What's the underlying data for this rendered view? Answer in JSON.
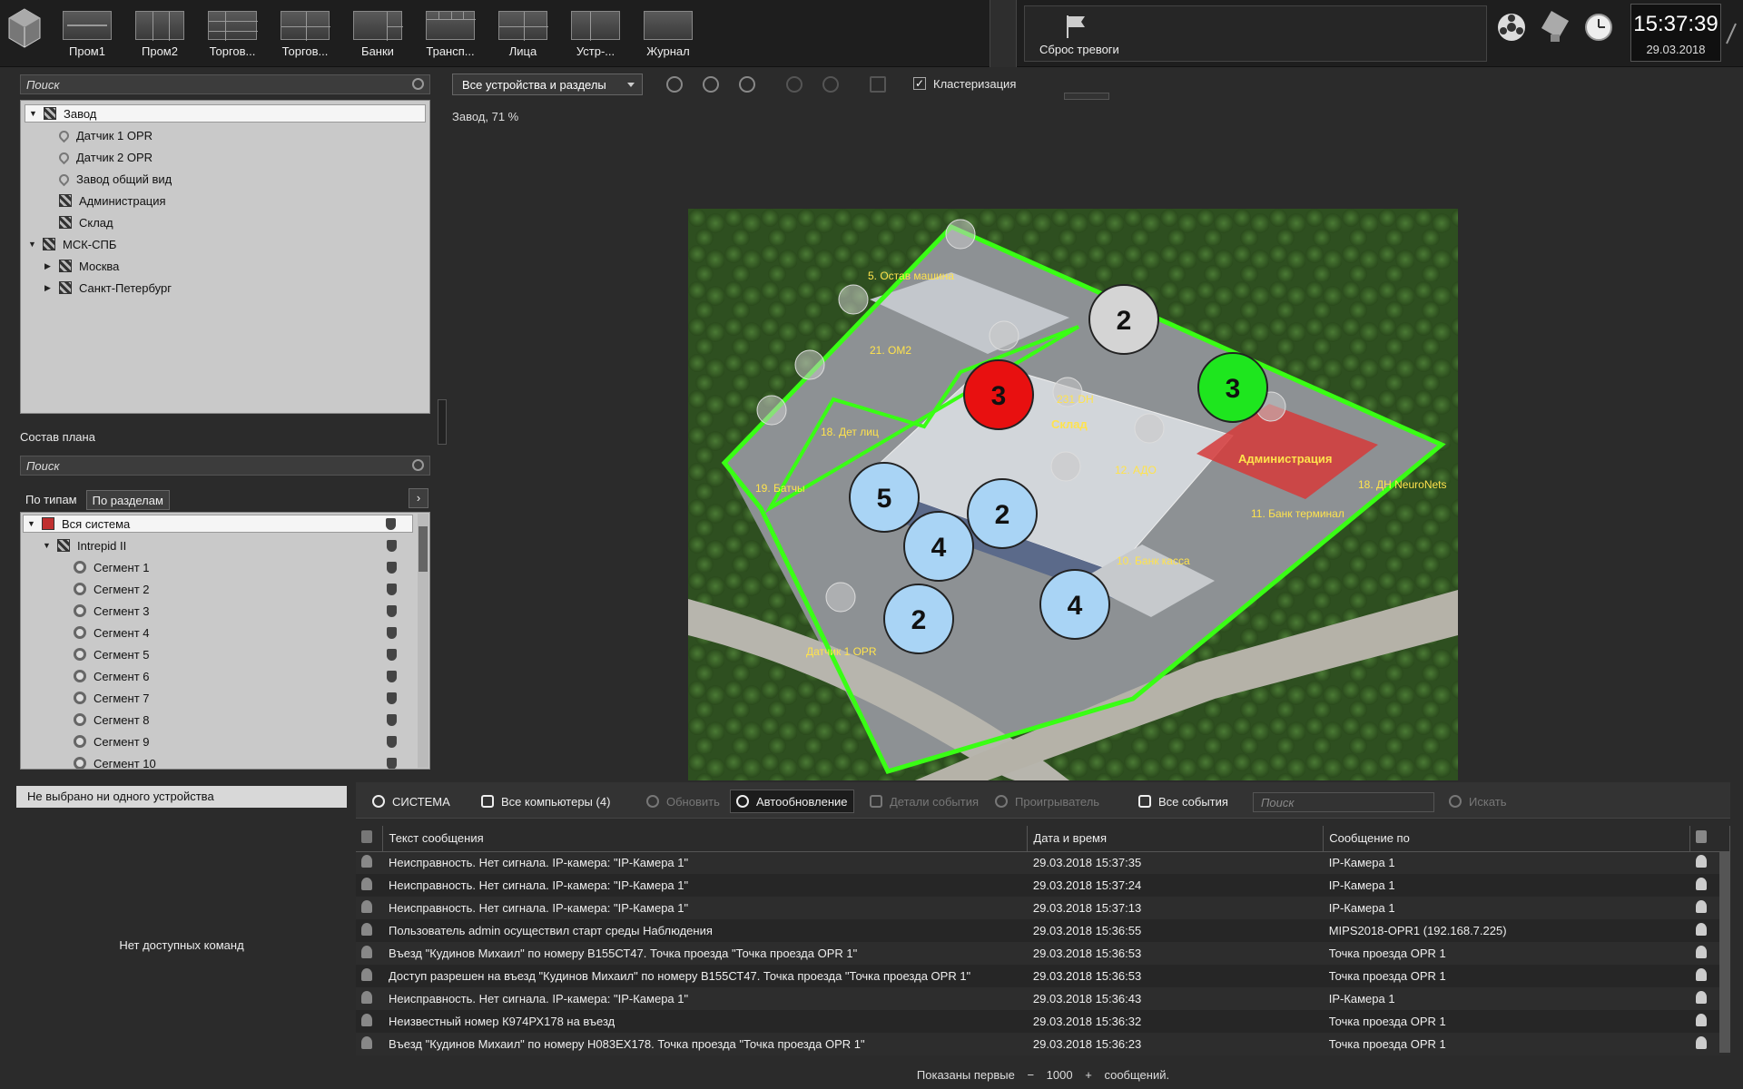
{
  "topbar": {
    "layouts": [
      {
        "label": "Пром1"
      },
      {
        "label": "Пром2"
      },
      {
        "label": "Торгов..."
      },
      {
        "label": "Торгов..."
      },
      {
        "label": "Банки"
      },
      {
        "label": "Трансп..."
      },
      {
        "label": "Лица"
      },
      {
        "label": "Устр-..."
      },
      {
        "label": "Журнал"
      }
    ],
    "alarm_reset": "Сброс тревоги",
    "time": "15:37:39",
    "date": "29.03.2018"
  },
  "left": {
    "search_placeholder": "Поиск",
    "tree": [
      {
        "label": "Завод",
        "level": 0,
        "type": "map",
        "expanded": true,
        "selected": true
      },
      {
        "label": "Датчик 1 OPR",
        "level": 1,
        "type": "pin"
      },
      {
        "label": "Датчик 2 OPR",
        "level": 1,
        "type": "pin"
      },
      {
        "label": "Завод общий вид",
        "level": 1,
        "type": "pin"
      },
      {
        "label": "Администрация",
        "level": 1,
        "type": "map"
      },
      {
        "label": "Склад",
        "level": 1,
        "type": "map"
      },
      {
        "label": "МСК-СПБ",
        "level": 0,
        "type": "map",
        "expanded": true
      },
      {
        "label": "Москва",
        "level": 1,
        "type": "map",
        "collapsed": true
      },
      {
        "label": "Санкт-Петербург",
        "level": 1,
        "type": "map",
        "collapsed": true
      }
    ],
    "plan_title": "Состав плана",
    "plan_search_placeholder": "Поиск",
    "tabs": {
      "by_type": "По типам",
      "by_section": "По разделам"
    },
    "plan_tree": [
      {
        "label": "Вся система",
        "level": 0
      },
      {
        "label": "Intrepid II",
        "level": 1
      },
      {
        "label": "Сегмент 1",
        "level": 2
      },
      {
        "label": "Сегмент 2",
        "level": 2
      },
      {
        "label": "Сегмент 3",
        "level": 2
      },
      {
        "label": "Сегмент 4",
        "level": 2
      },
      {
        "label": "Сегмент 5",
        "level": 2
      },
      {
        "label": "Сегмент 6",
        "level": 2
      },
      {
        "label": "Сегмент 7",
        "level": 2
      },
      {
        "label": "Сегмент 8",
        "level": 2
      },
      {
        "label": "Сегмент 9",
        "level": 2
      },
      {
        "label": "Сегмент 10",
        "level": 2
      }
    ]
  },
  "maptoolbar": {
    "filter_value": "Все устройства и разделы",
    "clustering_label": "Кластеризация",
    "clustering_checked": true
  },
  "map": {
    "title": "Завод, 71 %",
    "labels": [
      {
        "text": "5. Остав машина"
      },
      {
        "text": "21. OM2"
      },
      {
        "text": "231 DH"
      },
      {
        "text": "18. Дет лиц"
      },
      {
        "text": "Склад"
      },
      {
        "text": "12. АДО"
      },
      {
        "text": "Администрация"
      },
      {
        "text": "19. Батчы"
      },
      {
        "text": "11. Банк терминал"
      },
      {
        "text": "18. ДН NeuroNets"
      },
      {
        "text": "10. Банк касса"
      },
      {
        "text": "Датчик 1 OPR"
      }
    ],
    "clusters": [
      {
        "count": "2",
        "color": "#d4d4d4"
      },
      {
        "count": "3",
        "color": "#e81010"
      },
      {
        "count": "3",
        "color": "#1ee61e"
      },
      {
        "count": "5",
        "color": "#a9d4f5"
      },
      {
        "count": "2",
        "color": "#a9d4f5"
      },
      {
        "count": "4",
        "color": "#a9d4f5"
      },
      {
        "count": "2",
        "color": "#a9d4f5"
      },
      {
        "count": "4",
        "color": "#a9d4f5"
      }
    ]
  },
  "bottomleft": {
    "header": "Не выбрано ни одного устройства",
    "message": "Нет доступных команд"
  },
  "events": {
    "toolbar": {
      "system": "СИСТЕМА",
      "computers": "Все компьютеры (4)",
      "refresh": "Обновить",
      "autorefresh": "Автообновление",
      "details": "Детали события",
      "player": "Проигрыватель",
      "all_events": "Все события",
      "search_placeholder": "Поиск",
      "find": "Искать"
    },
    "columns": {
      "text": "Текст сообщения",
      "datetime": "Дата и время",
      "source": "Сообщение по"
    },
    "rows": [
      {
        "text": "Неисправность. Нет сигнала. IP-камера: \"IP-Камера 1\"",
        "datetime": "29.03.2018 15:37:35",
        "source": "IP-Камера 1"
      },
      {
        "text": "Неисправность. Нет сигнала. IP-камера: \"IP-Камера 1\"",
        "datetime": "29.03.2018 15:37:24",
        "source": "IP-Камера 1"
      },
      {
        "text": "Неисправность. Нет сигнала. IP-камера: \"IP-Камера 1\"",
        "datetime": "29.03.2018 15:37:13",
        "source": "IP-Камера 1"
      },
      {
        "text": "Пользователь admin осуществил старт среды Наблюдения",
        "datetime": "29.03.2018 15:36:55",
        "source": "MIPS2018-OPR1 (192.168.7.225)"
      },
      {
        "text": "Въезд \"Кудинов Михаил\" по номеру В155СТ47. Точка проезда \"Точка проезда OPR 1\"",
        "datetime": "29.03.2018 15:36:53",
        "source": "Точка проезда OPR 1"
      },
      {
        "text": "Доступ разрешен на въезд \"Кудинов Михаил\" по номеру В155СТ47. Точка проезда \"Точка проезда OPR 1\"",
        "datetime": "29.03.2018 15:36:53",
        "source": "Точка проезда OPR 1"
      },
      {
        "text": "Неисправность. Нет сигнала. IP-камера: \"IP-Камера 1\"",
        "datetime": "29.03.2018 15:36:43",
        "source": "IP-Камера 1"
      },
      {
        "text": "Неизвестный номер К974РХ178 на въезд",
        "datetime": "29.03.2018 15:36:32",
        "source": "Точка проезда OPR 1"
      },
      {
        "text": "Въезд \"Кудинов Михаил\" по номеру Н083ЕХ178. Точка проезда \"Точка проезда OPR 1\"",
        "datetime": "29.03.2018 15:36:23",
        "source": "Точка проезда OPR 1"
      }
    ],
    "footer": {
      "prefix": "Показаны первые",
      "minus": "−",
      "count": "1000",
      "plus": "+",
      "suffix": "сообщений."
    }
  }
}
